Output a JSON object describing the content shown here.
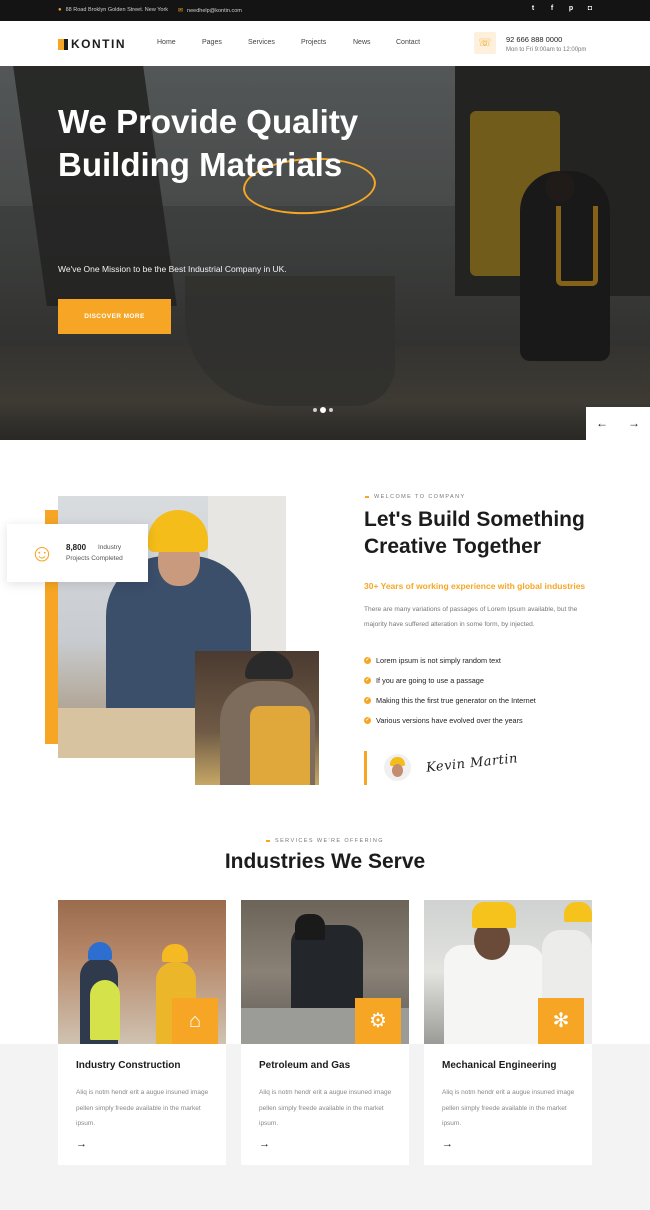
{
  "topbar": {
    "address": "88 Road Broklyn Golden Street. New York",
    "email": "needhelp@kontin.com",
    "social": [
      {
        "icon": "twitter-icon",
        "glyph": "t"
      },
      {
        "icon": "facebook-icon",
        "glyph": "f"
      },
      {
        "icon": "pinterest-icon",
        "glyph": "p"
      },
      {
        "icon": "instagram-icon",
        "glyph": "◘"
      }
    ]
  },
  "header": {
    "logo": "KONTIN",
    "nav": [
      "Home",
      "Pages",
      "Services",
      "Projects",
      "News",
      "Contact"
    ],
    "phone": "92 666 888 0000",
    "hours": "Mon to Fri 9:00am to 12:00pm"
  },
  "hero": {
    "title_line1_a": "We Provide ",
    "title_line1_b": "Quality",
    "title_line2": "Building Materials",
    "subtitle": "We've One Mission to be the Best Industrial Company in UK.",
    "button": "DISCOVER MORE",
    "prev_arrow": "←",
    "next_arrow": "→",
    "active_slide": 2,
    "slide_count": 3
  },
  "about": {
    "stat_number": "8,800",
    "stat_word": "Industry",
    "stat_label": "Projects Completed",
    "tagline": "WELCOME TO COMPANY",
    "title_line1": "Let's Build Something",
    "title_line2": "Creative Together",
    "highlight": "30+ Years of working experience with global industries",
    "text": "There are many variations of passages of Lorem Ipsum available, but the majority have suffered alteration in some form, by injected.",
    "checklist": [
      "Lorem ipsum is not simply random text",
      "If you are going to use a passage",
      "Making this the first true generator on the Internet",
      "Various versions have evolved over the years"
    ],
    "signature": "Kevin Martin"
  },
  "services": {
    "tagline": "SERVICES WE'RE OFFERING",
    "title": "Industries We Serve",
    "cards": [
      {
        "title": "Industry Construction",
        "text": "Aliq is notm hendr erit a augue insuned image pellen simply freede available in the market ipsum.",
        "icon": "factory-icon",
        "arrow": "→"
      },
      {
        "title": "Petroleum and Gas",
        "text": "Aliq is notm hendr erit a augue insuned image pellen simply freede available in the market ipsum.",
        "icon": "oil-gas-icon",
        "arrow": "→"
      },
      {
        "title": "Mechanical Engineering",
        "text": "Aliq is notm hendr erit a augue insuned image pellen simply freede available in the market ipsum.",
        "icon": "gears-icon",
        "arrow": "→"
      }
    ]
  },
  "colors": {
    "accent": "#f6a624",
    "dark": "#1c1c1c",
    "topbar": "#141414"
  }
}
